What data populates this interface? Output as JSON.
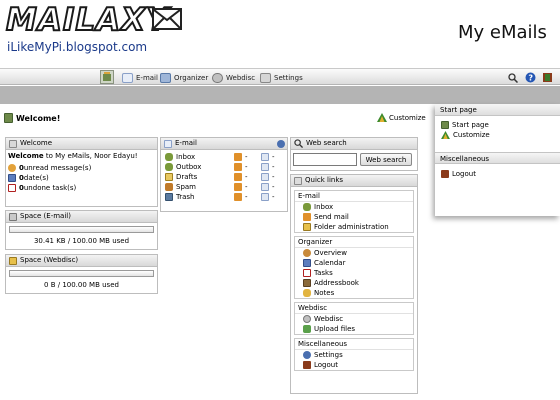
{
  "header": {
    "logo_text": "MAILAXY",
    "blog_url": "iLikeMyPi.blogspot.com",
    "app_title": "My eMails"
  },
  "toolbar": {
    "items": [
      {
        "label": "E-mail",
        "icon": "email-icon"
      },
      {
        "label": "Organizer",
        "icon": "organizer-icon"
      },
      {
        "label": "Webdisc",
        "icon": "webdisc-icon"
      },
      {
        "label": "Settings",
        "icon": "settings-icon"
      }
    ]
  },
  "welcome_bar": {
    "title": "Welcome!",
    "customize": "Customize"
  },
  "welcome_panel": {
    "title": "Welcome",
    "greeting_prefix": "Welcome",
    "greeting_rest": " to My eMails, Noor Edayu!",
    "stats": [
      {
        "count": "0",
        "label": " unread message(s)"
      },
      {
        "count": "0",
        "label": " date(s)"
      },
      {
        "count": "0",
        "label": " undone task(s)"
      }
    ]
  },
  "space_email": {
    "title": "Space (E-mail)",
    "usage": "30.41 KB / 100.00 MB used",
    "fraction": 0.0003
  },
  "space_webdisc": {
    "title": "Space (Webdisc)",
    "usage": "0 B / 100.00 MB used",
    "fraction": 0
  },
  "email_panel": {
    "title": "E-mail",
    "folders": [
      {
        "name": "Inbox",
        "v1": "-",
        "v2": "-"
      },
      {
        "name": "Outbox",
        "v1": "-",
        "v2": "-"
      },
      {
        "name": "Drafts",
        "v1": "-",
        "v2": "-"
      },
      {
        "name": "Spam",
        "v1": "-",
        "v2": "-"
      },
      {
        "name": "Trash",
        "v1": "-",
        "v2": "-"
      }
    ]
  },
  "web_search": {
    "title": "Web search",
    "button": "Web search",
    "value": ""
  },
  "quick_links": {
    "title": "Quick links",
    "groups": [
      {
        "title": "E-mail",
        "items": [
          "Inbox",
          "Send mail",
          "Folder administration"
        ]
      },
      {
        "title": "Organizer",
        "items": [
          "Overview",
          "Calendar",
          "Tasks",
          "Addressbook",
          "Notes"
        ]
      },
      {
        "title": "Webdisc",
        "items": [
          "Webdisc",
          "Upload files"
        ]
      },
      {
        "title": "Miscellaneous",
        "items": [
          "Settings",
          "Logout"
        ]
      }
    ]
  },
  "side_menu": {
    "start_title": "Start page",
    "start_items": [
      "Start page",
      "Customize"
    ],
    "misc_title": "Miscellaneous",
    "misc_items": [
      "Logout"
    ]
  },
  "colors": {
    "toolbar_top": "#fbfbfb",
    "band": "#b4b4b4",
    "link_blue": "#1b3a8a"
  }
}
